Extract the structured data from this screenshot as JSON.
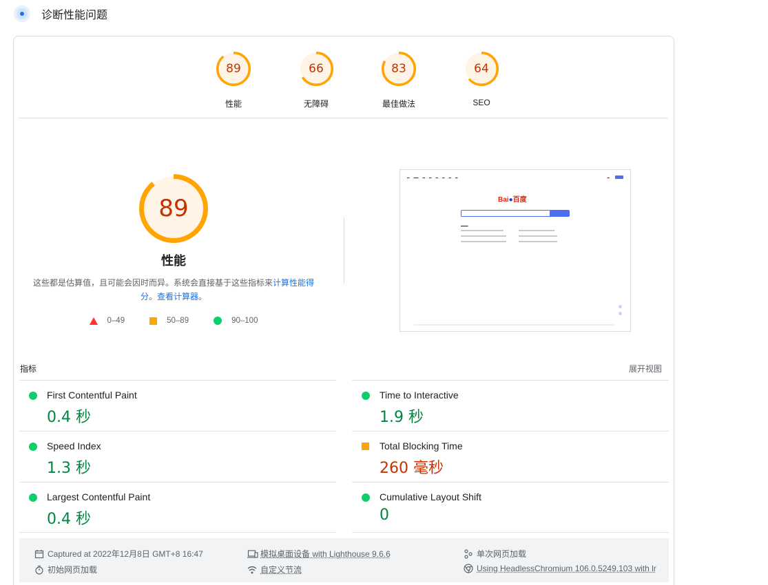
{
  "header": {
    "title": "诊断性能问题"
  },
  "gauges": [
    {
      "score": "89",
      "label": "性能",
      "value": 0.89
    },
    {
      "score": "66",
      "label": "无障碍",
      "value": 0.66
    },
    {
      "score": "83",
      "label": "最佳做法",
      "value": 0.83
    },
    {
      "score": "64",
      "label": "SEO",
      "value": 0.64
    }
  ],
  "performance": {
    "score": "89",
    "value": 0.89,
    "title": "性能",
    "desc_text": "这些都是估算值，且可能会因时而异。系统会直接基于这些指标来",
    "desc_link1": "计算性能得分",
    "desc_sep": "。",
    "desc_link2": "查看计算器",
    "desc_end": "。"
  },
  "legend": [
    {
      "shape": "triangle",
      "label": "0–49",
      "color": "#ff3333"
    },
    {
      "shape": "square",
      "label": "50–89",
      "color": "#ffa400"
    },
    {
      "shape": "circle",
      "label": "90–100",
      "color": "#0cce6b"
    }
  ],
  "metrics": {
    "header": "指标",
    "expand_label": "展开视图",
    "items": [
      {
        "name": "First Contentful Paint",
        "value": "0.4 秒",
        "status": "pass"
      },
      {
        "name": "Time to Interactive",
        "value": "1.9 秒",
        "status": "pass"
      },
      {
        "name": "Speed Index",
        "value": "1.3 秒",
        "status": "pass"
      },
      {
        "name": "Total Blocking Time",
        "value": "260 毫秒",
        "status": "average"
      },
      {
        "name": "Largest Contentful Paint",
        "value": "0.4 秒",
        "status": "pass"
      },
      {
        "name": "Cumulative Layout Shift",
        "value": "0",
        "status": "pass"
      }
    ]
  },
  "footer": {
    "captured": "Captured at 2022年12月8日 GMT+8 16:47",
    "device": "模拟桌面设备 with Lighthouse 9.6.6",
    "session": "单次网页加载",
    "initial_load": "初始网页加载",
    "throttling": "自定义节流",
    "browser": "Using HeadlessChromium 106.0.5249.103 with lr"
  },
  "colors": {
    "average": "#ffa400",
    "pass": "#0cce6b",
    "fail": "#ff3333",
    "link": "#1a73e8"
  }
}
